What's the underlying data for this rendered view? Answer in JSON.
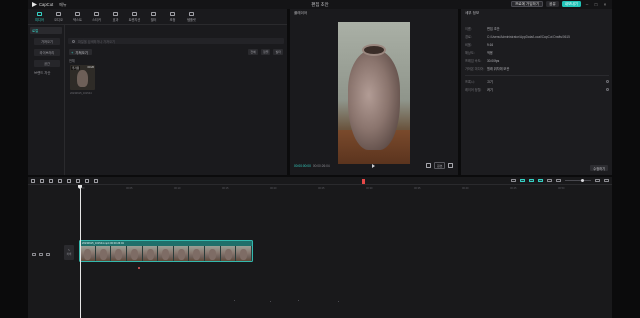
{
  "titlebar": {
    "app_name": "CapCut",
    "menu_label": "메뉴",
    "project_title": "편집 초안",
    "pro_label": "프로에 가입하기",
    "share_label": "공유",
    "export_label": "내보내기"
  },
  "media": {
    "tools": [
      {
        "label": "미디어",
        "active": true
      },
      {
        "label": "오디오",
        "active": false
      },
      {
        "label": "텍스트",
        "active": false
      },
      {
        "label": "스티커",
        "active": false
      },
      {
        "label": "효과",
        "active": false
      },
      {
        "label": "트랜지션",
        "active": false
      },
      {
        "label": "필터",
        "active": false
      },
      {
        "label": "조정",
        "active": false
      },
      {
        "label": "템플릿",
        "active": false
      }
    ],
    "sidebar": {
      "local": "로컬",
      "import_sub": "가져오기",
      "library": "라이브러리",
      "spaces": "공간",
      "brand": "브랜드 자산"
    },
    "search_placeholder": "파일을 검색하거나 가져오기",
    "import_label": "가져오기",
    "view_all": "전체",
    "view_sort": "정렬",
    "view_filter": "필터",
    "all_label": "전체",
    "thumb_tag": "추가됨",
    "thumb_duration": "00:26",
    "thumb_name": "20230615_161544"
  },
  "player": {
    "title": "플레이어",
    "timecode_current": "00:00:00:00",
    "timecode_total": "00:00:26:04",
    "ratio_label": "원본"
  },
  "details": {
    "title": "세부 정보",
    "rows": [
      {
        "key": "이름:",
        "value": "편집 초안"
      },
      {
        "key": "경로:",
        "value": "C:/Users/Administrator/AppData/Local/CapCut Drafts/0615"
      },
      {
        "key": "비율:",
        "value": "9:16"
      },
      {
        "key": "해상도:",
        "value": "적용"
      },
      {
        "key": "프레임 속도:",
        "value": "30.00fps"
      },
      {
        "key": "가져온 미디어:",
        "value": "원래 위치에 보관"
      }
    ],
    "rows2": [
      {
        "key": "프록시:",
        "value": "끄기"
      },
      {
        "key": "레이어 정렬:",
        "value": "켜기"
      }
    ],
    "modify_label": "수정하기"
  },
  "timeline": {
    "ticks": [
      "00:00",
      "00:05",
      "00:10",
      "00:15",
      "00:20",
      "00:25",
      "00:30",
      "00:35",
      "00:40",
      "00:45",
      "00:50"
    ],
    "cover_label": "커버",
    "clip_label": "20230615_161544.mp4  00:00:26:04"
  }
}
